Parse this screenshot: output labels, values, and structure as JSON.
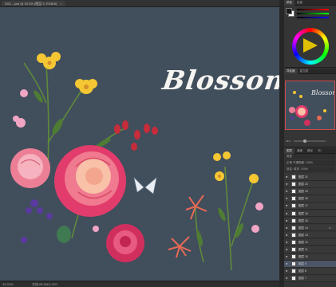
{
  "document": {
    "tab_label": "DSC...psd @ 33.3% (图层 9, RGB/8)",
    "tab_close": "×"
  },
  "canvas": {
    "title_text": "Blossom",
    "background": "#414e5c"
  },
  "statusbar": {
    "zoom": "33.33%",
    "doc_info": "文档:89.9M/2.22G"
  },
  "panels": {
    "color_tabs": [
      "颜色",
      "色板"
    ],
    "navigator_tabs": [
      "导航器",
      "直方图"
    ],
    "layers_tabs": [
      "图层",
      "通道",
      "路径",
      "3D"
    ],
    "navigator_zoom": "33%"
  },
  "layers_toolbar": {
    "kind": "类型",
    "mode": "正常",
    "opacity_label": "不透明度:",
    "opacity": "100%",
    "lock_label": "锁定:",
    "fill_label": "填充:",
    "fill": "100%"
  },
  "layers": [
    {
      "name": "图层 21",
      "extra": ""
    },
    {
      "name": "图层 20",
      "extra": ""
    },
    {
      "name": "图层 19",
      "extra": ""
    },
    {
      "name": "图层 18",
      "extra": ""
    },
    {
      "name": "图层 17",
      "extra": ""
    },
    {
      "name": "图层 16",
      "extra": ""
    },
    {
      "name": "图层 15",
      "extra": ""
    },
    {
      "name": "图层 14",
      "extra": "fx"
    },
    {
      "name": "图层 13",
      "extra": ""
    },
    {
      "name": "图层 12",
      "extra": ""
    },
    {
      "name": "图层 11",
      "extra": ""
    },
    {
      "name": "图层 10",
      "extra": ""
    },
    {
      "name": "图层 9",
      "extra": ""
    },
    {
      "name": "图层 8",
      "extra": ""
    },
    {
      "name": "图层 7",
      "extra": ""
    }
  ],
  "colors": {
    "accent_selected_layer": "#4b5566",
    "navigator_frame": "#d24a4a"
  }
}
